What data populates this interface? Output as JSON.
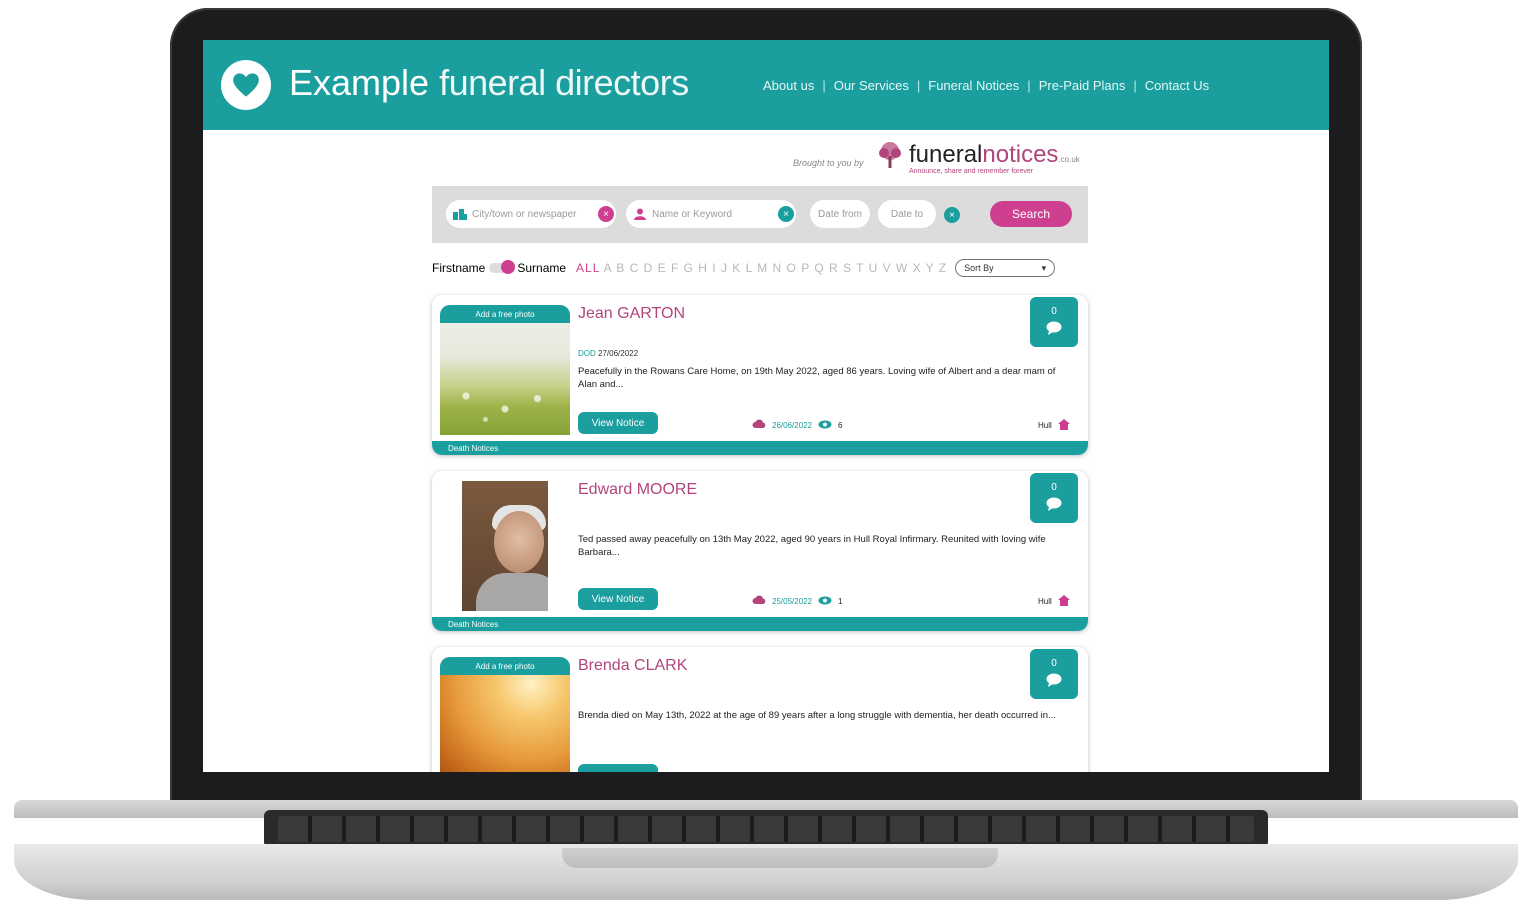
{
  "header": {
    "brand_part1": "Example",
    "brand_part2": "funeral directors",
    "nav": [
      "About us",
      "Our Services",
      "Funeral Notices",
      "Pre-Paid Plans",
      "Contact Us"
    ]
  },
  "brought_by": "Brought to you by",
  "partner": {
    "name_part1": "funeral",
    "name_part2": "notices",
    "tld": ".co.uk",
    "tagline": "Announce, share and remember forever"
  },
  "search": {
    "location_placeholder": "City/town or newspaper",
    "name_placeholder": "Name or Keyword",
    "date_from": "Date from",
    "date_to": "Date to",
    "button": "Search"
  },
  "filter": {
    "firstname": "Firstname",
    "surname": "Surname",
    "all": "ALL",
    "letters": "A B C D E F G H I J K L M N O P Q R S T U V W X Y Z",
    "sort_label": "Sort By"
  },
  "notices": [
    {
      "photo_label": "Add a free photo",
      "name": "Jean GARTON",
      "dod_label": "DOD",
      "dod": "27/06/2022",
      "description": "Peacefully in the Rowans Care Home, on 19th May 2022, aged 86 years. Loving wife of Albert and a dear mam of Alan and...",
      "view": "View Notice",
      "date": "26/06/2022",
      "views": "6",
      "location": "Hull",
      "category": "Death Notices",
      "comments": "0"
    },
    {
      "photo_label": "",
      "name": "Edward MOORE",
      "dod_label": "",
      "dod": "",
      "description": "Ted passed away peacefully on 13th May 2022, aged 90 years in Hull Royal Infirmary. Reunited with loving wife Barbara...",
      "view": "View Notice",
      "date": "25/05/2022",
      "views": "1",
      "location": "Hull",
      "category": "Death Notices",
      "comments": "0"
    },
    {
      "photo_label": "Add a free photo",
      "name": "Brenda CLARK",
      "description": "Brenda died on May 13th, 2022 at the age of 89 years after a long struggle with dementia, her death occurred in...",
      "comments": "0"
    }
  ],
  "colors": {
    "teal": "#1a9e9e",
    "pink": "#b2457c",
    "search_pink": "#cf3f8f"
  }
}
